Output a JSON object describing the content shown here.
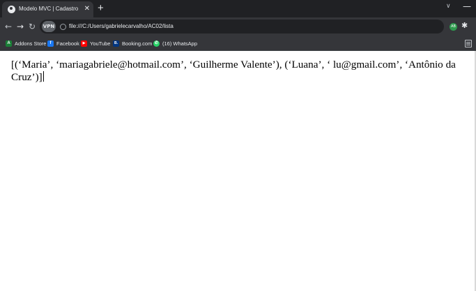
{
  "tab": {
    "title": "Modelo MVC | Cadastro",
    "close": "✕"
  },
  "tabstrip": {
    "new_tab": "+",
    "search": "∨",
    "minimize": "—"
  },
  "toolbar": {
    "back": "←",
    "forward": "→",
    "reload": "↻",
    "vpn_badge": "VPN",
    "url": "file:///C:/Users/gabrielecarvalho/AC02/lista",
    "extension_badge": "AB",
    "extensions_icon": "puzzle-icon"
  },
  "bookmarks": [
    {
      "label": "Addons Store",
      "icon": "A",
      "color": "#1a7f37"
    },
    {
      "label": "Facebook",
      "icon": "f",
      "color": "#1877f2"
    },
    {
      "label": "YouTube",
      "icon": "▶",
      "color": "#ff0000"
    },
    {
      "label": "Booking.com",
      "icon": "B.",
      "color": "#003580"
    },
    {
      "label": "(16) WhatsApp",
      "icon": "✆",
      "color": "#25d366"
    }
  ],
  "page": {
    "content": "[(‘Maria’, ‘mariagabriele@hotmail.com’, ‘Guilherme Valente’), (‘Luana’, ‘ lu@gmail.com’, ‘Antônio da Cruz’)]"
  }
}
